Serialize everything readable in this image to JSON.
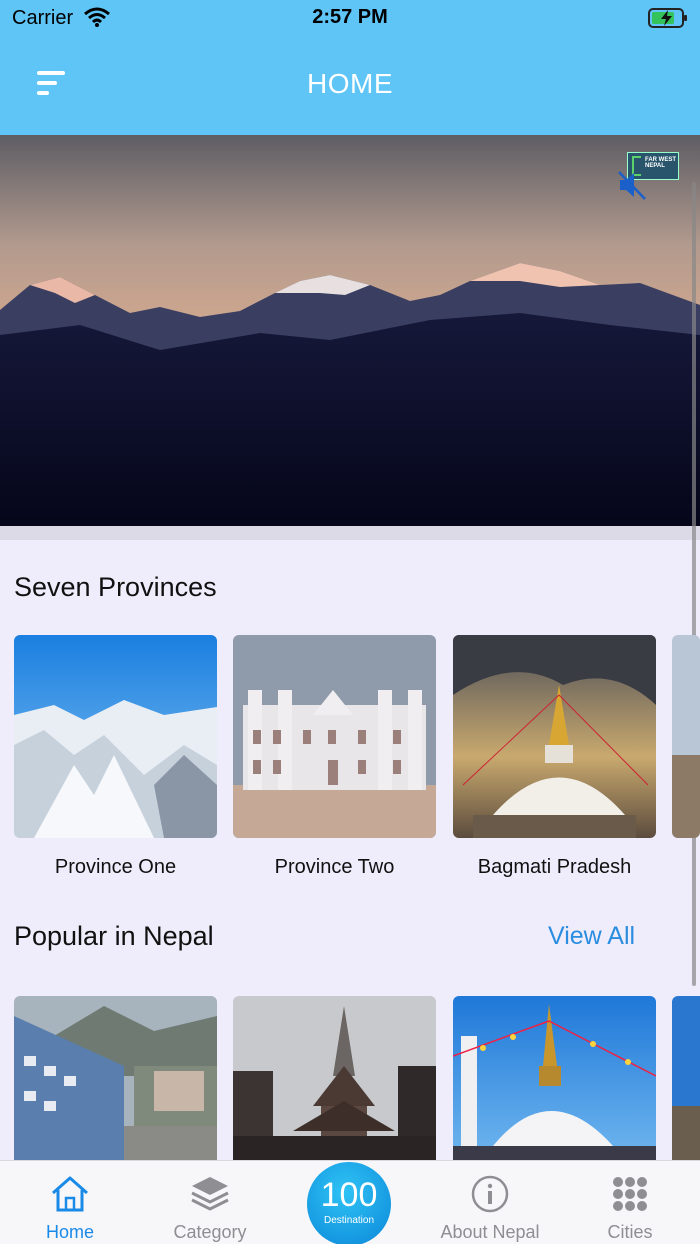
{
  "status_bar": {
    "carrier": "Carrier",
    "time": "2:57 PM"
  },
  "header": {
    "title": "HOME"
  },
  "hero": {
    "logo_text": "FAR WEST NEPAL",
    "mute_icon": "speaker-muted-icon"
  },
  "provinces": {
    "title": "Seven Provinces",
    "items": [
      {
        "label": "Province One"
      },
      {
        "label": "Province Two"
      },
      {
        "label": "Bagmati Pradesh"
      }
    ]
  },
  "popular": {
    "title": "Popular in Nepal",
    "view_all": "View All"
  },
  "tabbar": {
    "tabs": [
      {
        "label": "Home",
        "icon": "home-icon"
      },
      {
        "label": "Category",
        "icon": "layers-icon"
      },
      {
        "label": "About Nepal",
        "icon": "info-icon"
      },
      {
        "label": "Cities",
        "icon": "grid-icon"
      }
    ],
    "center": {
      "number": "100",
      "sub": "Destination"
    }
  },
  "colors": {
    "header": "#5ec5f6",
    "accent": "#1a8ae8",
    "background": "#efedfb"
  }
}
